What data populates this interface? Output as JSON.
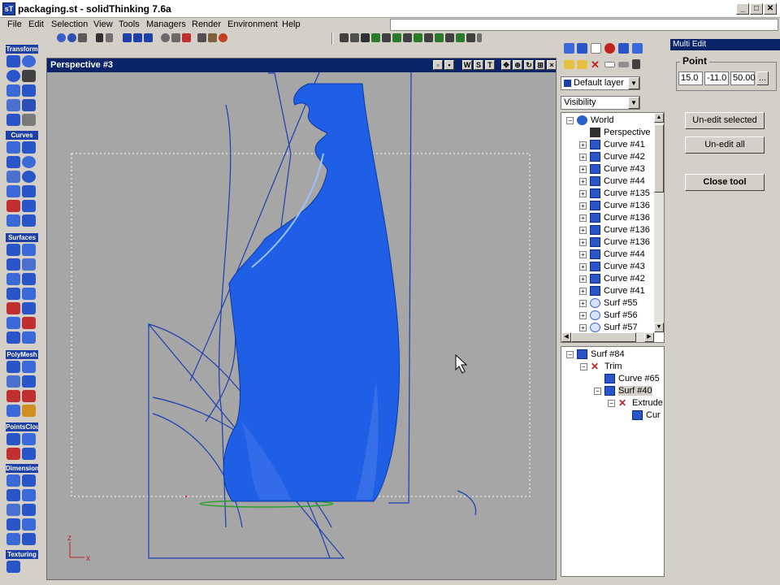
{
  "window": {
    "title": "packaging.st - solidThinking 7.6a",
    "controls": {
      "minimize": "_",
      "maximize": "□",
      "close": "✕"
    }
  },
  "menu": [
    "File",
    "Edit",
    "Selection",
    "View",
    "Tools",
    "Managers",
    "Render",
    "Environment",
    "Help"
  ],
  "toolsets": [
    "Transform",
    "Curves",
    "Surfaces",
    "PolyMesh",
    "PointsClou",
    "Dimension",
    "Texturing"
  ],
  "viewport": {
    "title": "Perspective #3",
    "view_buttons": [
      "W",
      "S",
      "T"
    ],
    "axis_labels": {
      "x": "x",
      "z": "z"
    }
  },
  "layer_panel": {
    "layer_select": "Default layer",
    "filter_select": "Visibility"
  },
  "tree": [
    {
      "label": "World",
      "level": 0,
      "expander": "−",
      "icon": "globe-icon"
    },
    {
      "label": "Perspective",
      "level": 1,
      "expander": "",
      "icon": "camera-icon"
    },
    {
      "label": "Curve #41",
      "level": 1,
      "expander": "+",
      "icon": "cube-icon"
    },
    {
      "label": "Curve #42",
      "level": 1,
      "expander": "+",
      "icon": "cube-icon"
    },
    {
      "label": "Curve #43",
      "level": 1,
      "expander": "+",
      "icon": "cube-icon"
    },
    {
      "label": "Curve #44",
      "level": 1,
      "expander": "+",
      "icon": "cube-icon"
    },
    {
      "label": "Curve #135",
      "level": 1,
      "expander": "+",
      "icon": "cube-icon"
    },
    {
      "label": "Curve #136",
      "level": 1,
      "expander": "+",
      "icon": "cube-icon"
    },
    {
      "label": "Curve #136",
      "level": 1,
      "expander": "+",
      "icon": "cube-icon"
    },
    {
      "label": "Curve #136",
      "level": 1,
      "expander": "+",
      "icon": "cube-icon"
    },
    {
      "label": "Curve #136",
      "level": 1,
      "expander": "+",
      "icon": "cube-icon"
    },
    {
      "label": "Curve #44",
      "level": 1,
      "expander": "+",
      "icon": "cube-icon"
    },
    {
      "label": "Curve #43",
      "level": 1,
      "expander": "+",
      "icon": "cube-icon"
    },
    {
      "label": "Curve #42",
      "level": 1,
      "expander": "+",
      "icon": "cube-icon"
    },
    {
      "label": "Curve #41",
      "level": 1,
      "expander": "+",
      "icon": "cube-icon"
    },
    {
      "label": "Surf #55",
      "level": 1,
      "expander": "+",
      "icon": "hidden-icon"
    },
    {
      "label": "Surf #56",
      "level": 1,
      "expander": "+",
      "icon": "hidden-icon"
    },
    {
      "label": "Surf #57",
      "level": 1,
      "expander": "+",
      "icon": "hidden-icon"
    }
  ],
  "history_tree": [
    {
      "label": "Surf #84",
      "level": 0,
      "expander": "−",
      "icon": "cube-icon",
      "selected": false
    },
    {
      "label": "Trim",
      "level": 1,
      "expander": "−",
      "icon": "trim-icon",
      "selected": false
    },
    {
      "label": "Curve #65",
      "level": 2,
      "expander": "",
      "icon": "cube-icon",
      "selected": false
    },
    {
      "label": "Surf #40",
      "level": 2,
      "expander": "−",
      "icon": "cube-icon",
      "selected": true
    },
    {
      "label": "Extrude",
      "level": 3,
      "expander": "−",
      "icon": "trim-icon",
      "selected": false
    },
    {
      "label": "Cur",
      "level": 4,
      "expander": "",
      "icon": "cube-icon",
      "selected": false
    }
  ],
  "multi_edit": {
    "header": "Multi Edit",
    "group_label": "Point",
    "point": {
      "x": "15.0",
      "y": "-11.0",
      "z": "50.00",
      "more": "..."
    },
    "buttons": {
      "unedit_selected": "Un-edit selected",
      "unedit_all": "Un-edit all",
      "close_tool": "Close tool"
    }
  },
  "colors": {
    "model_blue": "#1f5fe6",
    "title_blue": "#0a246a",
    "viewport_bg": "#a6a6a6",
    "chrome": "#d4d0c8"
  }
}
